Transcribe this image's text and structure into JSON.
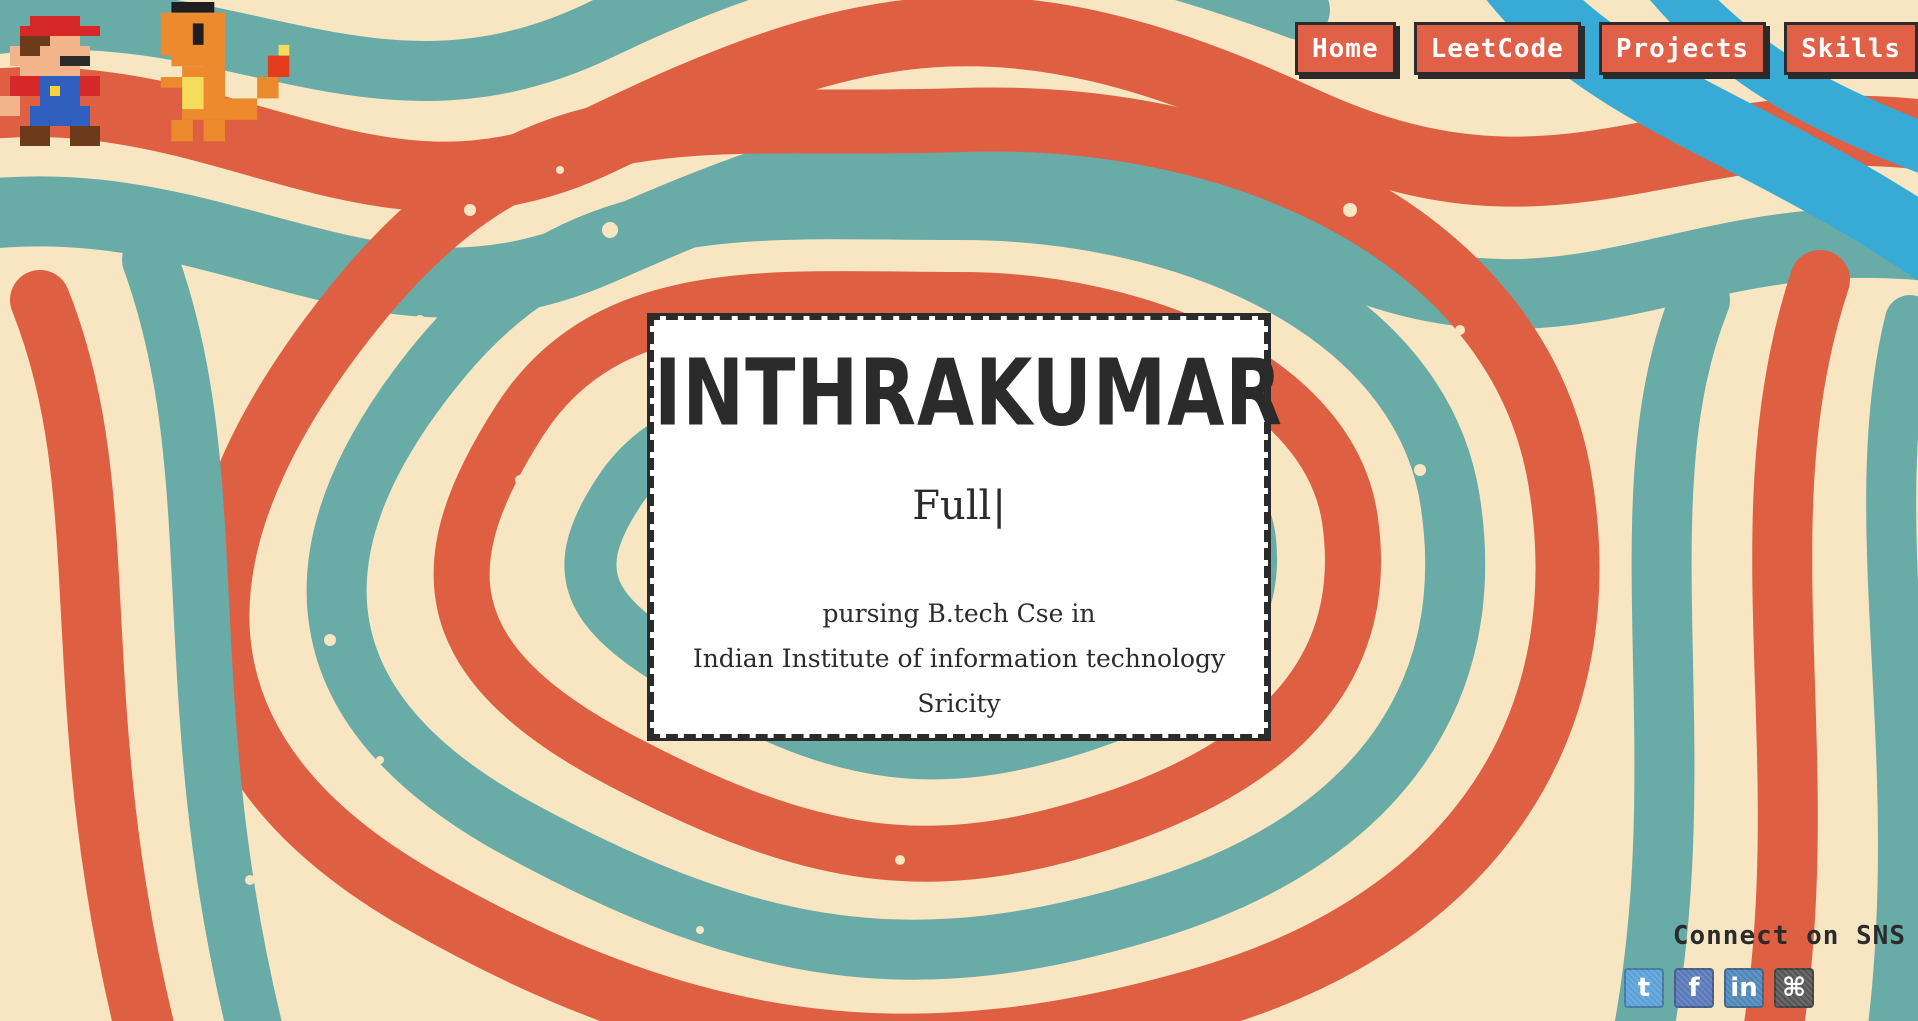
{
  "nav": {
    "items": [
      {
        "label": "Home"
      },
      {
        "label": "LeetCode"
      },
      {
        "label": "Projects"
      },
      {
        "label": "Skills"
      }
    ]
  },
  "hero": {
    "name": "INTHRAKUMAR",
    "typed_text": "Full",
    "cursor": "|",
    "description": [
      "pursing B.tech Cse in",
      "Indian Institute of information technology",
      "Sricity"
    ]
  },
  "sns": {
    "title": "Connect on SNS",
    "icons": [
      {
        "name": "twitter-icon",
        "glyph": "t",
        "color": "#5aa0d8"
      },
      {
        "name": "facebook-icon",
        "glyph": "f",
        "color": "#5a78b8"
      },
      {
        "name": "linkedin-icon",
        "glyph": "in",
        "color": "#4f86b8"
      },
      {
        "name": "github-icon",
        "glyph": "⌘",
        "color": "#555555"
      }
    ]
  },
  "colors": {
    "cream": "#f8e6c2",
    "red": "#df5f43",
    "teal": "#69aba7",
    "blue": "#37abd6",
    "dark": "#2b2b2b",
    "nav_button": "#e06048"
  }
}
